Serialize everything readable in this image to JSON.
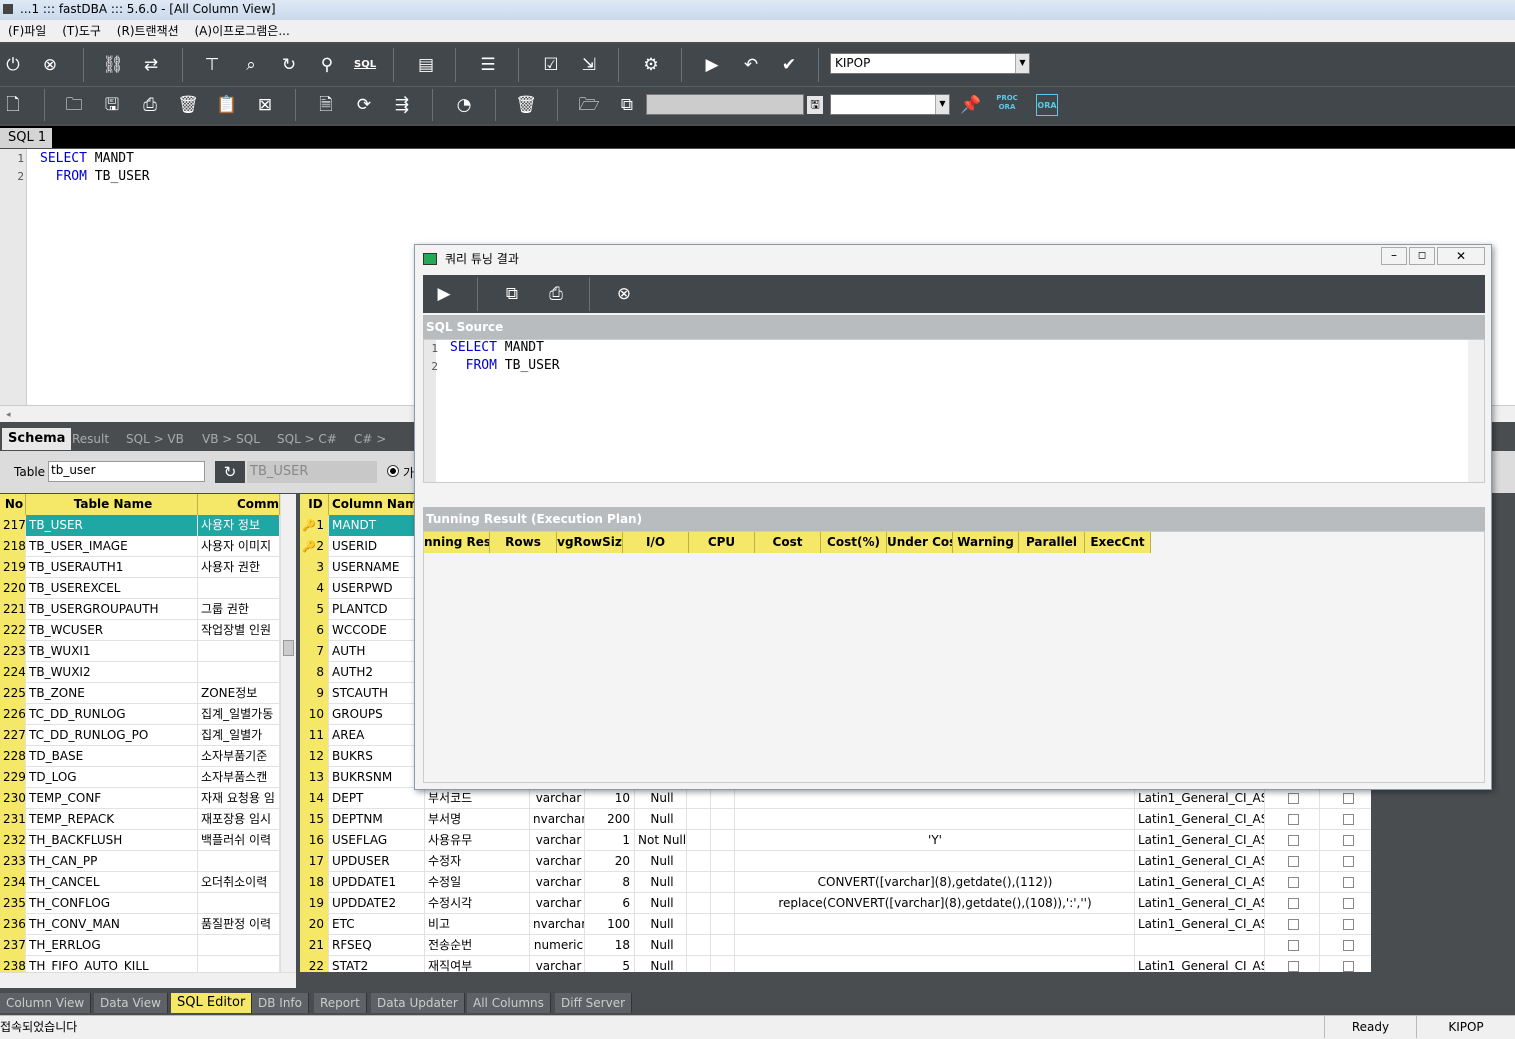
{
  "window": {
    "title": "...1 ::: fastDBA ::: 5.6.0 - [All Column View]"
  },
  "menu": [
    "(F)파일",
    "(T)도구",
    "(R)트랜잭션",
    "(A)이프로그램은..."
  ],
  "toolbar": {
    "connection": "KIPOP",
    "sql_label": "SQL",
    "proc_label": "PROC ORA",
    "ora_label": "ORA"
  },
  "sql_tab": "SQL 1",
  "editor": {
    "lines": [
      {
        "n": "1",
        "kw": "SELECT",
        "rest": " MANDT"
      },
      {
        "n": "2",
        "kw": "  FROM",
        "rest": " TB_USER"
      }
    ]
  },
  "schema_tabs": [
    "Schema",
    "Result",
    "SQL > VB",
    "VB > SQL",
    "SQL > C#",
    "C# > SQL"
  ],
  "schema": {
    "table_label": "Table",
    "table_input": "tb_user",
    "table_display": "TB_USER",
    "radio_label": "가"
  },
  "left_grid": {
    "headers": [
      "No",
      "Table Name",
      "Comm"
    ],
    "rows": [
      [
        "217",
        "TB_USER",
        "사용자 정보"
      ],
      [
        "218",
        "TB_USER_IMAGE",
        "사용자 이미지"
      ],
      [
        "219",
        "TB_USERAUTH1",
        "사용자 권한"
      ],
      [
        "220",
        "TB_USEREXCEL",
        ""
      ],
      [
        "221",
        "TB_USERGROUPAUTH",
        "그룹 권한"
      ],
      [
        "222",
        "TB_WCUSER",
        "작업장별 인원"
      ],
      [
        "223",
        "TB_WUXI1",
        ""
      ],
      [
        "224",
        "TB_WUXI2",
        ""
      ],
      [
        "225",
        "TB_ZONE",
        "ZONE정보"
      ],
      [
        "226",
        "TC_DD_RUNLOG",
        "집계_일별가동"
      ],
      [
        "227",
        "TC_DD_RUNLOG_PO",
        "집계_일별가"
      ],
      [
        "228",
        "TD_BASE",
        "소자부품기준"
      ],
      [
        "229",
        "TD_LOG",
        "소자부품스캔"
      ],
      [
        "230",
        "TEMP_CONF",
        "자재 요청용 임"
      ],
      [
        "231",
        "TEMP_REPACK",
        "재포장용 임시"
      ],
      [
        "232",
        "TH_BACKFLUSH",
        "백플러쉬 이력"
      ],
      [
        "233",
        "TH_CAN_PP",
        ""
      ],
      [
        "234",
        "TH_CANCEL",
        "오더취소이력"
      ],
      [
        "235",
        "TH_CONFLOG",
        ""
      ],
      [
        "236",
        "TH_CONV_MAN",
        "품질판정 이력"
      ],
      [
        "237",
        "TH_ERRLOG",
        ""
      ],
      [
        "238",
        "TH_FIFO_AUTO_KILL",
        ""
      ]
    ]
  },
  "right_grid": {
    "headers": [
      "ID",
      "Column Name"
    ],
    "rows": [
      [
        "1",
        "MANDT",
        "",
        "",
        "",
        "",
        "",
        "",
        ""
      ],
      [
        "2",
        "USERID",
        "",
        "",
        "",
        "",
        "",
        "",
        ""
      ],
      [
        "3",
        "USERNAME",
        "",
        "",
        "",
        "",
        "",
        "",
        ""
      ],
      [
        "4",
        "USERPWD",
        "",
        "",
        "",
        "",
        "",
        "",
        ""
      ],
      [
        "5",
        "PLANTCD",
        "",
        "",
        "",
        "",
        "",
        "",
        ""
      ],
      [
        "6",
        "WCCODE",
        "",
        "",
        "",
        "",
        "",
        "",
        ""
      ],
      [
        "7",
        "AUTH",
        "",
        "",
        "",
        "",
        "",
        "",
        ""
      ],
      [
        "8",
        "AUTH2",
        "",
        "",
        "",
        "",
        "",
        "",
        ""
      ],
      [
        "9",
        "STCAUTH",
        "",
        "",
        "",
        "",
        "",
        "",
        ""
      ],
      [
        "10",
        "GROUPS",
        "",
        "",
        "",
        "",
        "",
        "",
        ""
      ],
      [
        "11",
        "AREA",
        "",
        "",
        "",
        "",
        "",
        "",
        ""
      ],
      [
        "12",
        "BUKRS",
        "",
        "",
        "",
        "",
        "",
        "",
        ""
      ],
      [
        "13",
        "BUKRSNM",
        "",
        "",
        "",
        "",
        "",
        "",
        ""
      ],
      [
        "14",
        "DEPT",
        "부서코드",
        "varchar",
        "10",
        "Null",
        "",
        "Latin1_General_CI_AS",
        ""
      ],
      [
        "15",
        "DEPTNM",
        "부서명",
        "nvarchar",
        "200",
        "Null",
        "",
        "Latin1_General_CI_AS",
        ""
      ],
      [
        "16",
        "USEFLAG",
        "사용유무",
        "varchar",
        "1",
        "Not Null",
        "'Y'",
        "Latin1_General_CI_AS",
        ""
      ],
      [
        "17",
        "UPDUSER",
        "수정자",
        "varchar",
        "20",
        "Null",
        "",
        "Latin1_General_CI_AS",
        ""
      ],
      [
        "18",
        "UPDDATE1",
        "수정일",
        "varchar",
        "8",
        "Null",
        "CONVERT([varchar](8),getdate(),(112))",
        "Latin1_General_CI_AS",
        ""
      ],
      [
        "19",
        "UPDDATE2",
        "수정시각",
        "varchar",
        "6",
        "Null",
        "replace(CONVERT([varchar](8),getdate(),(108)),':','')",
        "Latin1_General_CI_AS",
        ""
      ],
      [
        "20",
        "ETC",
        "비고",
        "nvarchar",
        "100",
        "Null",
        "",
        "Latin1_General_CI_AS",
        ""
      ],
      [
        "21",
        "RFSEQ",
        "전송순번",
        "numeric",
        "18",
        "Null",
        "",
        "",
        ""
      ],
      [
        "22",
        "STAT2",
        "재직여부",
        "varchar",
        "5",
        "Null",
        "",
        "Latin1_General_CI_AS",
        ""
      ]
    ]
  },
  "bottom_tabs": [
    "Column View",
    "Data View",
    "SQL Editor",
    "DB Info",
    "Report",
    "Data Updater",
    "All Columns",
    "Diff Server"
  ],
  "status": {
    "message": "접속되었습니다",
    "state": "Ready",
    "connection": "KIPOP"
  },
  "dialog": {
    "title": "쿼리 튜닝 결과",
    "source_label": "SQL Source",
    "source_lines": [
      {
        "n": "1",
        "kw": "SELECT",
        "rest": " MANDT"
      },
      {
        "n": "2",
        "kw": "  FROM",
        "rest": " TB_USER"
      }
    ],
    "plan_label": "Tunning Result (Execution Plan)",
    "plan_headers": [
      "nning Res",
      "Rows",
      "vgRowSiz",
      "I/O",
      "CPU",
      "Cost",
      "Cost(%)",
      "Under Cost",
      "Warning",
      "Parallel",
      "ExecCnt"
    ]
  }
}
